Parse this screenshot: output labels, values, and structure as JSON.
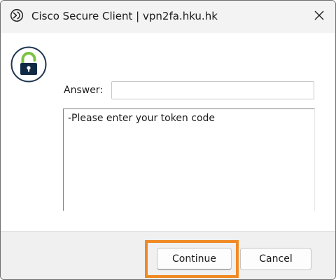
{
  "window": {
    "title": "Cisco Secure Client | vpn2fa.hku.hk",
    "app_icon": "cisco-secure-client-icon",
    "close_icon": "close-icon"
  },
  "dialog": {
    "lock_icon": "lock-icon",
    "answer_label": "Answer:",
    "answer_value": "",
    "message": "-Please enter your token code"
  },
  "buttons": {
    "continue_label": "Continue",
    "cancel_label": "Cancel"
  },
  "colors": {
    "highlight": "#f08a24",
    "lock_shackle": "#7cc242",
    "lock_body": "#0f2a44"
  }
}
